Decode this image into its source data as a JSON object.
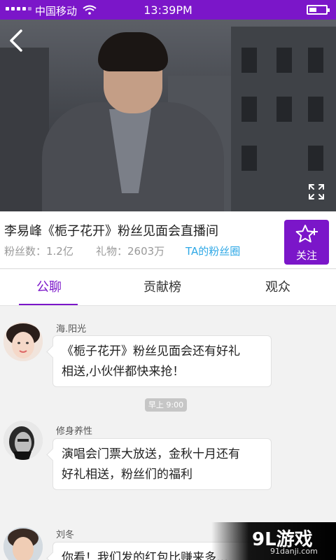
{
  "status_bar": {
    "carrier": "中国移动",
    "time": "13:39PM",
    "battery_level": 0.45
  },
  "live": {
    "title": "李易峰《栀子花开》粉丝见面会直播间",
    "fans_count": "粉丝数：1.2亿",
    "gifts": "礼物：2603万",
    "fan_circle_link": "TA的粉丝圈",
    "follow_label": "关注"
  },
  "tabs": [
    {
      "label": "公聊",
      "active": true
    },
    {
      "label": "贡献榜",
      "active": false
    },
    {
      "label": "观众",
      "active": false
    }
  ],
  "chat": {
    "messages": [
      {
        "sender": "海.阳光",
        "lines": [
          "《栀子花开》粉丝见面会还有好礼",
          "相送,小伙伴都快来抢！"
        ]
      },
      {
        "sender": "修身养性",
        "lines": [
          "演唱会门票大放送，金秋十月还有",
          "好礼相送，粉丝们的福利"
        ]
      },
      {
        "sender": "刘冬",
        "lines": [
          "你看！我们发的红包比赚来多…"
        ]
      }
    ],
    "time_separator": "早上 9:00"
  },
  "watermark": {
    "logo": "9L游戏",
    "site": "91danji.com"
  },
  "colors": {
    "accent": "#7b16c9",
    "link": "#2ea8e6"
  }
}
